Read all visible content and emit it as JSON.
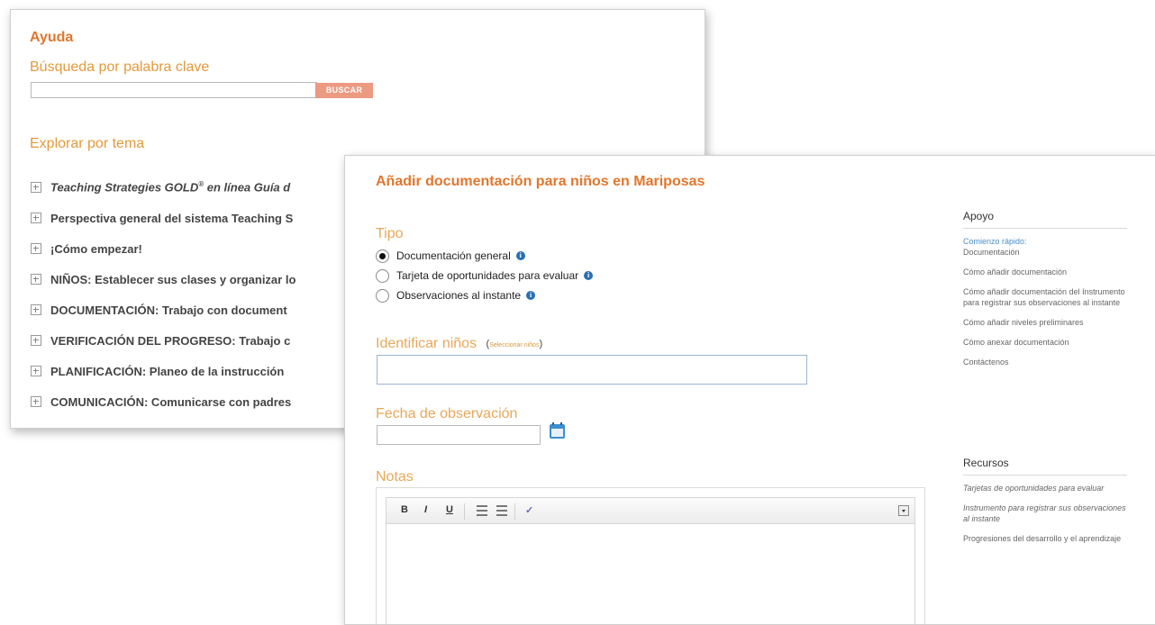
{
  "help": {
    "title": "Ayuda",
    "keyword_label": "Búsqueda por palabra clave",
    "search_value": "",
    "search_button": "BUSCAR",
    "explore_label": "Explorar por tema",
    "topics": [
      {
        "main": "Teaching Strategies GOLD",
        "sup": "®",
        "rest": " en línea Guía d"
      },
      {
        "main": "Perspectiva general del sistema Teaching S"
      },
      {
        "main": "¡Cómo empezar!"
      },
      {
        "main": "NIÑOS: Establecer sus clases y organizar lo"
      },
      {
        "main": "DOCUMENTACIÓN: Trabajo con document"
      },
      {
        "main": "VERIFICACIÓN DEL PROGRESO: Trabajo c"
      },
      {
        "main": "PLANIFICACIÓN: Planeo de la instrucción"
      },
      {
        "main": "COMUNICACIÓN: Comunicarse con padres"
      }
    ]
  },
  "doc": {
    "title": "Añadir documentación para niños en Mariposas",
    "type_label": "Tipo",
    "type_options": [
      {
        "label": "Documentación general",
        "checked": true
      },
      {
        "label": "Tarjeta de oportunidades para evaluar",
        "checked": false
      },
      {
        "label": "Observaciones al instante",
        "checked": false
      }
    ],
    "info_glyph": "i",
    "identify_label": "Identificar niños",
    "select_children_link": "Seleccionar niños",
    "identify_value": "",
    "date_label": "Fecha de observación",
    "date_value": "",
    "notes_label": "Notas",
    "toolbar": {
      "bold": "B",
      "italic": "I",
      "underline": "U"
    }
  },
  "sidebar": {
    "support_heading": "Apoyo",
    "quick_start_line1": "Comienzo rápido:",
    "quick_start_line2": "Documentación",
    "support_links": [
      "Cómo añadir documentación",
      "Cómo añadir documentación del Instrumento para registrar sus observaciones al instante",
      "Cómo añadir niveles preliminares",
      "Cómo anexar documentación",
      "Contáctenos"
    ],
    "resources_heading": "Recursos",
    "resource_links": [
      {
        "label": "Tarjetas de oportunidades para evaluar",
        "italic": true
      },
      {
        "label": "Instrumento para registrar sus observaciones al instante",
        "italic": true
      },
      {
        "label": "Progresiones del desarrollo y el aprendizaje",
        "italic": false
      }
    ]
  },
  "colors": {
    "accent": "#e2762c",
    "label": "#e8a85a",
    "button": "#ec9a81",
    "link": "#4a90c9"
  }
}
